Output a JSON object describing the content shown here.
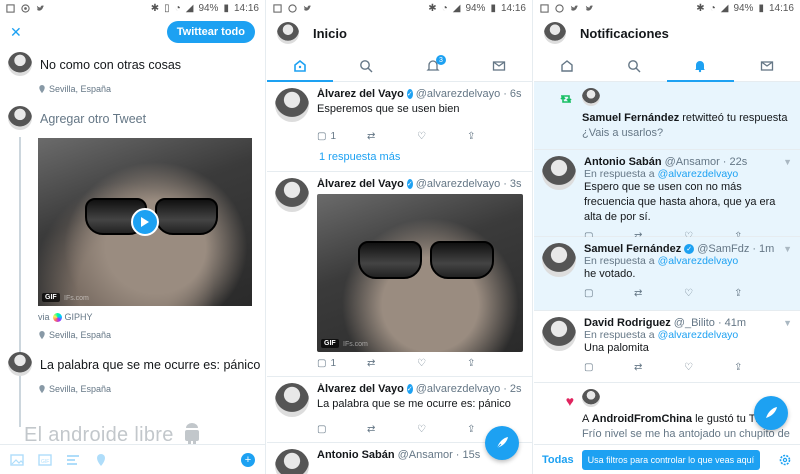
{
  "status": {
    "battery": "94%",
    "time": "14:16"
  },
  "composer": {
    "close_label": "✕",
    "tweet_all_label": "Twittear todo",
    "tweets": [
      {
        "text": "No como con otras cosas",
        "location": "Sevilla, España"
      },
      {
        "text": "Agregar otro Tweet",
        "gif_label": "GIF",
        "gif_watermark": "IFs.com",
        "via_label": "via",
        "via_source": "GIPHY",
        "location": "Sevilla, España"
      },
      {
        "text": "La palabra que se me ocurre es: pánico",
        "location": "Sevilla, España"
      }
    ],
    "watermark": "El androide libre"
  },
  "home": {
    "title": "Inicio",
    "notif_badge": "3",
    "tweets": [
      {
        "name": "Álvarez del Vayo",
        "handle": "@alvarezdelvayo",
        "time": "6s",
        "text": "Esperemos que se usen bien",
        "replies": "1"
      },
      {
        "name": "Álvarez del Vayo",
        "handle": "@alvarezdelvayo",
        "time": "3s",
        "text": "",
        "gif_label": "GIF",
        "gif_watermark": "IFs.com",
        "replies": "1"
      },
      {
        "name": "Álvarez del Vayo",
        "handle": "@alvarezdelvayo",
        "time": "2s",
        "text": "La palabra que se me ocurre es: pánico",
        "replies": ""
      },
      {
        "name": "Antonio Sabán",
        "handle": "@Ansamor",
        "time": "15s",
        "text": ""
      }
    ],
    "more_replies": "1 respuesta más"
  },
  "notifications": {
    "title": "Notificaciones",
    "items": [
      {
        "name": "Samuel Fernández",
        "action": "retwitteó tu respuesta",
        "text": "¿Vais a usarlos?"
      },
      {
        "name": "Antonio Sabán",
        "handle": "@Ansamor",
        "time": "22s",
        "reply_prefix": "En respuesta a",
        "reply_to": "@alvarezdelvayo",
        "text": "Espero que se usen con no más frecuencia que hasta ahora, que ya era alta de por sí."
      },
      {
        "name": "Samuel Fernández",
        "handle": "@SamFdz",
        "time": "1m",
        "reply_prefix": "En respuesta a",
        "reply_to": "@alvarezdelvayo",
        "text": "he votado."
      },
      {
        "name": "David Rodriguez",
        "handle": "@_Bilito",
        "time": "41m",
        "reply_prefix": "En respuesta a",
        "reply_to": "@alvarezdelvayo",
        "text": "Una palomita"
      },
      {
        "name": "AndroidFromChina",
        "action_prefix": "A",
        "action": "le gustó tu Twe",
        "text": "Frío nivel se me ha antojado un chupito de"
      }
    ],
    "filter_all": "Todas",
    "filter_tip": "Usa filtros para controlar lo que veas aquí"
  },
  "colors": {
    "accent": "#1da1f2",
    "retweet": "#17bf63",
    "like": "#e0245e"
  }
}
